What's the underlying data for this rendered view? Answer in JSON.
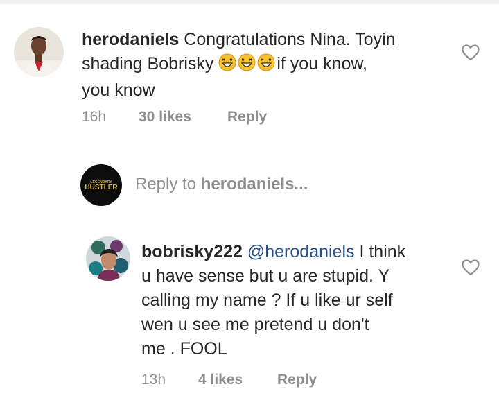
{
  "comment1": {
    "username": "herodaniels",
    "text_line1": "Congratulations Nina. Toyin",
    "text_line2a": "shading Bobrisky",
    "text_line2b": "if you know,",
    "text_line3": "you know",
    "emoji_icons": [
      "grinning-squint-emoji",
      "grinning-squint-emoji",
      "grinning-squint-emoji"
    ],
    "time": "16h",
    "likes": "30 likes",
    "reply": "Reply"
  },
  "reply_box": {
    "prefix": "Reply to ",
    "target": "herodaniels...",
    "avatar_text_top": "LEGENDARY",
    "avatar_text_main": "HUSTLER"
  },
  "comment2": {
    "username": "bobrisky222",
    "mention": "@herodaniels",
    "text_line1_rest": "I think",
    "text_line2": "u have sense but u are stupid. Y",
    "text_line3": "calling my name ? If u like ur self",
    "text_line4": "wen u see me pretend u don't",
    "text_line5": "me . FOOL",
    "time": "13h",
    "likes": "4 likes",
    "reply": "Reply"
  },
  "colors": {
    "text": "#262626",
    "muted": "#8e8e8e",
    "mention": "#27508a"
  }
}
